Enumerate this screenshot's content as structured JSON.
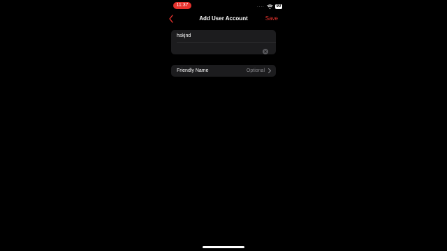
{
  "status_bar": {
    "time": "11:37",
    "signal_dots": "....",
    "battery": "90"
  },
  "nav": {
    "title": "Add User Account",
    "save_label": "Save",
    "back_icon": "chevron-left-icon"
  },
  "form": {
    "username_value": "hskjnd",
    "password_value": "",
    "clear_icon": "clear-x-icon"
  },
  "friendly_name": {
    "label": "Friendly Name",
    "value": "Optional",
    "chevron_icon": "chevron-right-icon"
  },
  "colors": {
    "accent": "#e5322d",
    "background": "#000000",
    "cell": "#1c1c1e",
    "secondary_text": "#8a8a8e"
  }
}
